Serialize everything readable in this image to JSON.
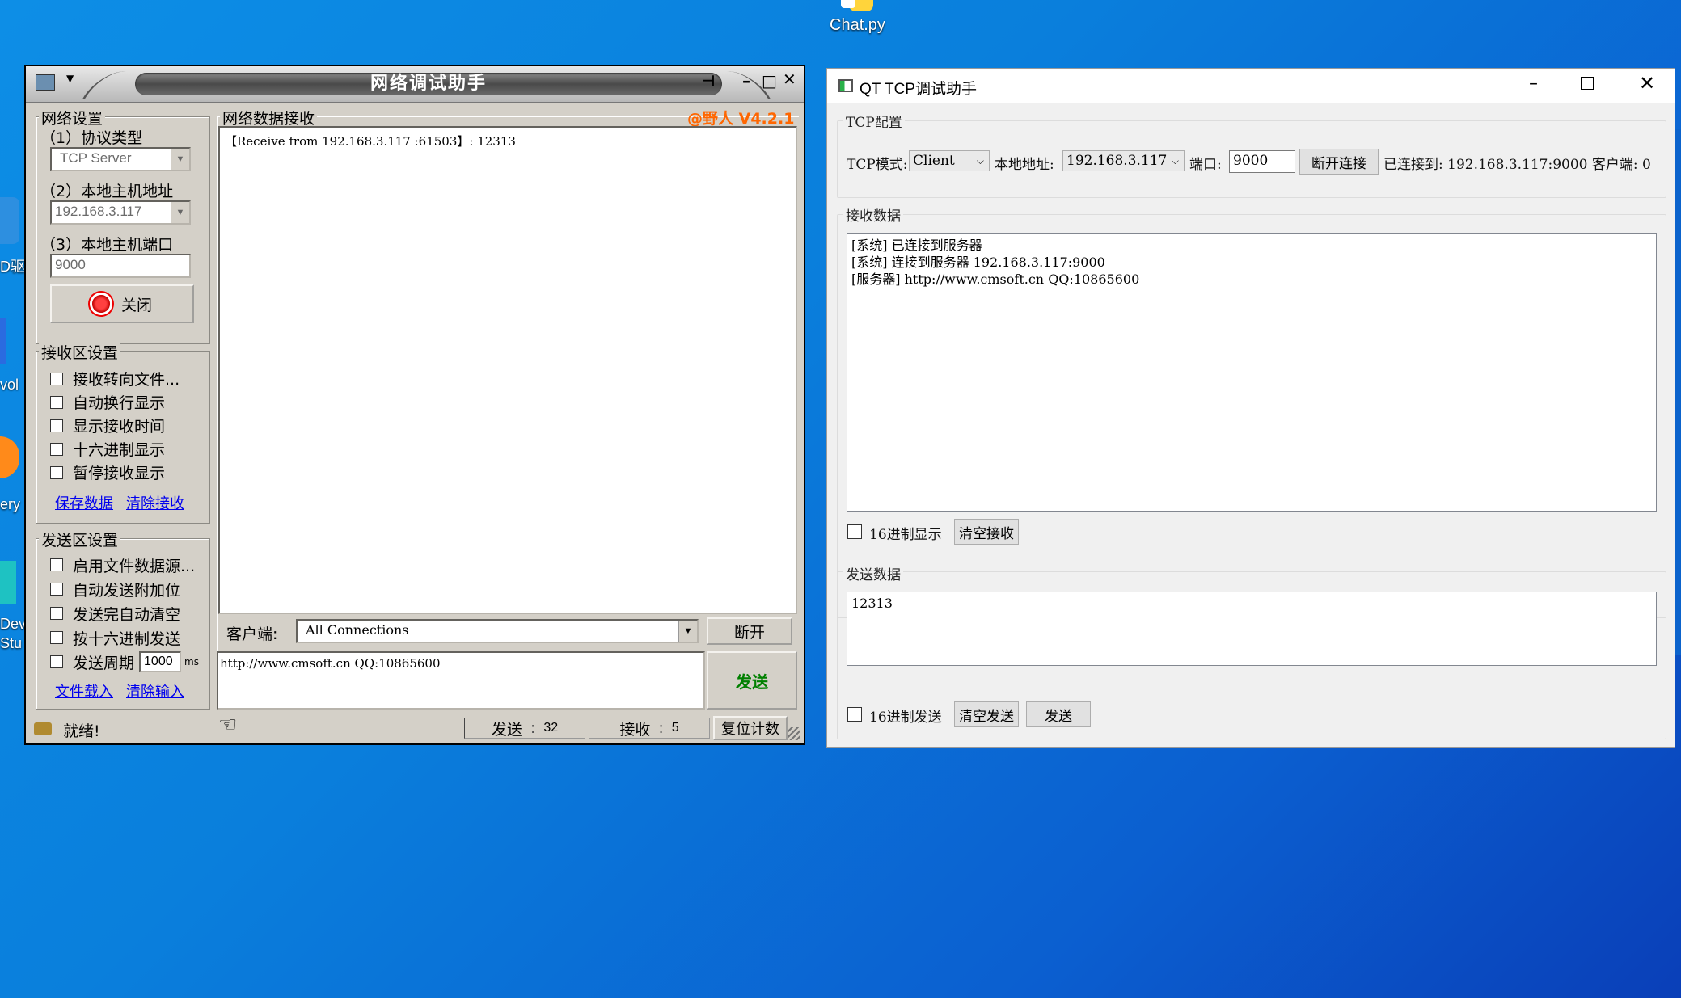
{
  "desktop": {
    "icon_label": "Chat.py",
    "edge_labels": [
      "D驱",
      "vol",
      "ery",
      "Dev",
      "Stu"
    ]
  },
  "netassist": {
    "title": "网络调试助手",
    "version_badge": "@野人 V4.2.1",
    "network_settings": {
      "group_title": "网络设置",
      "protocol_label": "（1）协议类型",
      "protocol_value": "TCP Server",
      "host_label": "（2）本地主机地址",
      "host_value": "192.168.3.117",
      "port_label": "（3）本地主机端口",
      "port_value": "9000",
      "close_button": "关闭"
    },
    "receive_settings": {
      "group_title": "接收区设置",
      "options": [
        "接收转向文件...",
        "自动换行显示",
        "显示接收时间",
        "十六进制显示",
        "暂停接收显示"
      ],
      "save_link": "保存数据",
      "clear_link": "清除接收"
    },
    "send_settings": {
      "group_title": "发送区设置",
      "options": [
        "启用文件数据源...",
        "自动发送附加位",
        "发送完自动清空",
        "按十六进制发送",
        "发送周期"
      ],
      "period_value": "1000",
      "period_unit": "ms",
      "load_link": "文件载入",
      "clear_link": "清除输入"
    },
    "receive_area": {
      "group_title": "网络数据接收",
      "content": "【Receive from 192.168.3.117 :61503】: 12313"
    },
    "client_bar": {
      "label": "客户端:",
      "value": "All Connections",
      "disconnect_button": "断开"
    },
    "send_area": {
      "content": "http://www.cmsoft.cn QQ:10865600",
      "send_button": "发送"
    },
    "status": {
      "text": "就绪!",
      "send_label": "发送",
      "send_count": "32",
      "recv_label": "接收",
      "recv_count": "5",
      "reset_button": "复位计数"
    }
  },
  "qt_tcp": {
    "title": "QT TCP调试助手",
    "config": {
      "group_title": "TCP配置",
      "mode_label": "TCP模式:",
      "mode_value": "Client",
      "addr_label": "本地地址:",
      "addr_value": "192.168.3.117",
      "port_label": "端口:",
      "port_value": "9000",
      "disconnect_button": "断开连接",
      "status_text": "已连接到: 192.168.3.117:9000 客户端: 0"
    },
    "receive": {
      "group_title": "接收数据",
      "lines": [
        "[系统] 已连接到服务器",
        "[系统] 连接到服务器 192.168.3.117:9000",
        "[服务器] http://www.cmsoft.cn QQ:10865600"
      ],
      "hex_label": "16进制显示",
      "clear_button": "清空接收"
    },
    "send": {
      "group_title": "发送数据",
      "content": "12313",
      "hex_label": "16进制发送",
      "clear_button": "清空发送",
      "send_button": "发送"
    }
  },
  "colors": {
    "desktop_blue": "#0a7fdc",
    "badge_orange": "#ff6600",
    "send_green": "#008000",
    "link_blue": "#0000ee"
  }
}
